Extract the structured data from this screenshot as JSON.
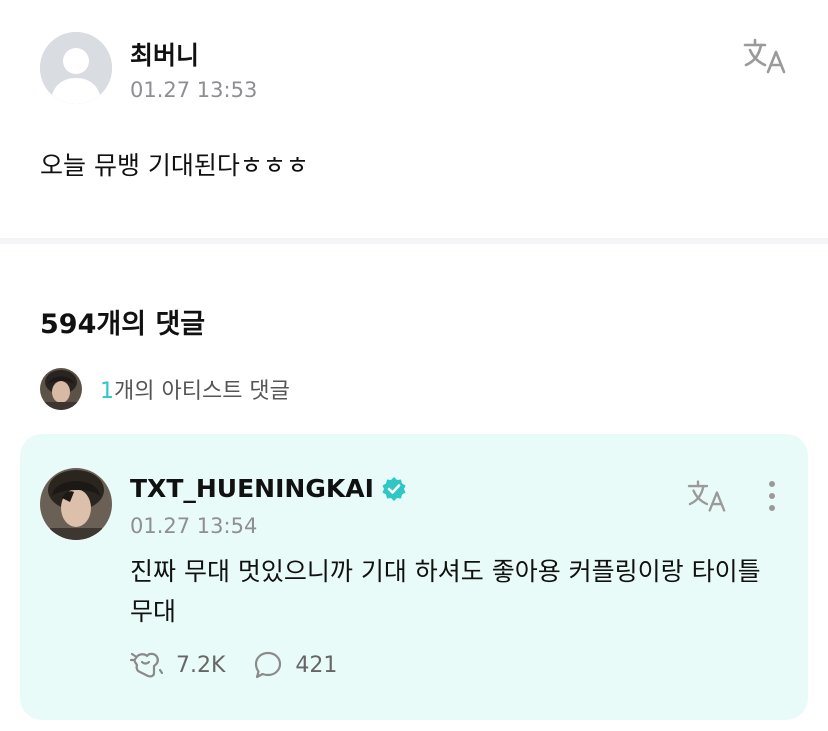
{
  "post": {
    "author": "최버니",
    "time": "01.27 13:53",
    "body": "오늘 뮤뱅 기대된다ㅎㅎㅎ"
  },
  "comments": {
    "title": "594개의 댓글",
    "artist_count": "1",
    "artist_label": "개의 아티스트 댓글"
  },
  "artist_comment": {
    "author": "TXT_HUENINGKAI",
    "time": "01.27 13:54",
    "text": "진짜 무대 멋있으니까 기대 하셔도 좋아용 커플링이랑 타이틀 무대",
    "likes": "7.2K",
    "replies": "421"
  },
  "colors": {
    "accent": "#2fc6c6",
    "card_bg": "#e9fbf8",
    "muted_text": "#8e8e93",
    "icon": "#9a9a9a"
  },
  "icons": {
    "translate": "translate-icon",
    "verified": "verified-badge-icon",
    "more": "more-vertical-icon",
    "cheer": "cheer-icon",
    "reply": "comment-bubble-icon"
  }
}
